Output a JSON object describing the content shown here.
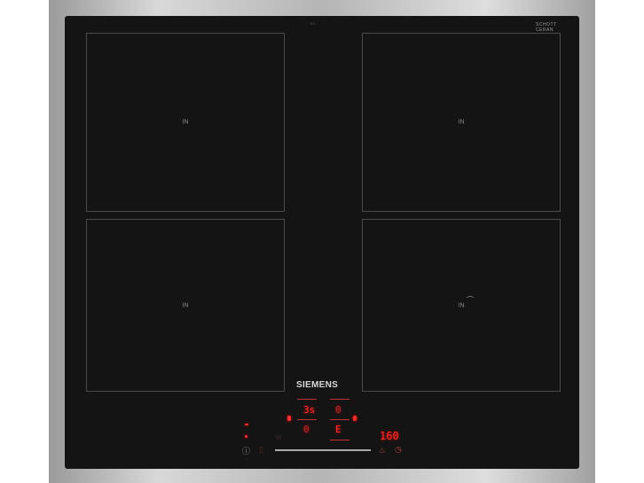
{
  "brand": "SIEMENS",
  "model_text": "EX...",
  "glass_brand": [
    "SCHOTT",
    "CERAN"
  ],
  "zones": [
    {
      "label": "IN"
    },
    {
      "label": "IN"
    },
    {
      "label": "IN"
    },
    {
      "label": "IN"
    }
  ],
  "displays": {
    "zone_front_left": "3s",
    "zone_rear_left": "0",
    "zone_rear_right": "0",
    "zone_front_right": "E",
    "timer": "160"
  },
  "icons": [
    "power-icon",
    "lock-icon",
    "favorite-star-icon",
    "frying-sensor-icon",
    "timer-icon"
  ],
  "accent_color": "#ff3030"
}
